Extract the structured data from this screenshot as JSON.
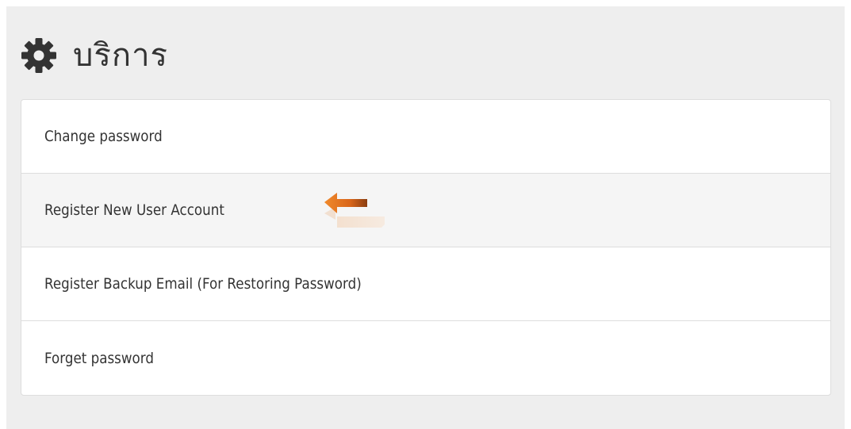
{
  "header": {
    "title": "บริการ",
    "icon": "gear-icon"
  },
  "services": [
    {
      "label": "Change password",
      "active": false
    },
    {
      "label": "Register New User Account",
      "active": true,
      "highlight_icon": "left-arrow-icon"
    },
    {
      "label": "Register Backup Email (For Restoring Password)",
      "active": false
    },
    {
      "label": "Forget password",
      "active": false
    }
  ],
  "colors": {
    "panel_bg": "#eeeeee",
    "active_row_bg": "#f5f5f5",
    "text": "#333333",
    "arrow": "#e8761d"
  }
}
